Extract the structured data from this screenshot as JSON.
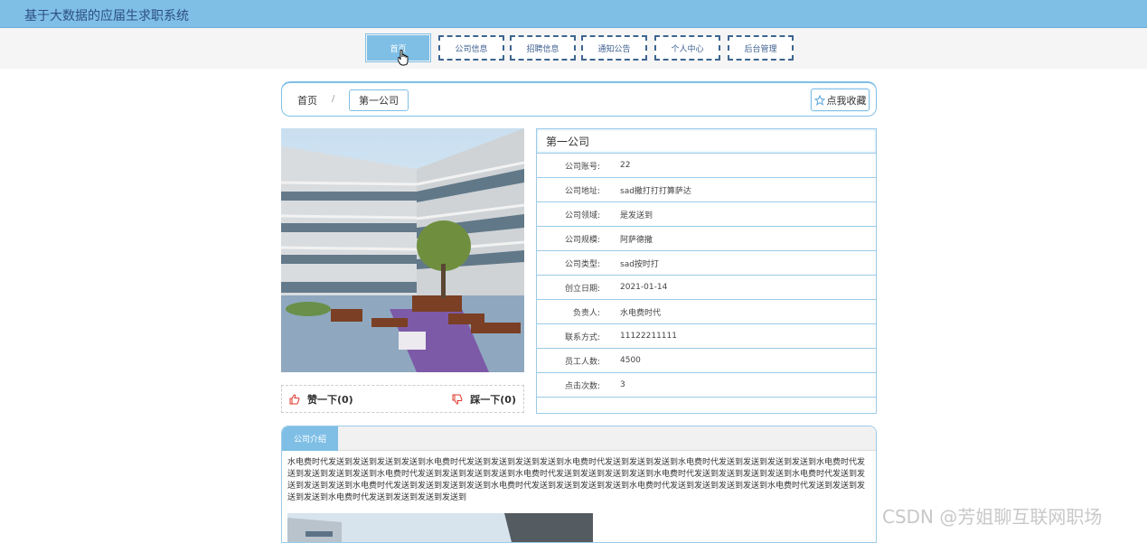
{
  "app": {
    "title": "基于大数据的应届生求职系统"
  },
  "nav": {
    "items": [
      {
        "label": "首页"
      },
      {
        "label": "公司信息"
      },
      {
        "label": "招聘信息"
      },
      {
        "label": "通知公告"
      },
      {
        "label": "个人中心"
      },
      {
        "label": "后台管理"
      }
    ]
  },
  "breadcrumb": {
    "home": "首页",
    "separator": "/",
    "current": "第一公司"
  },
  "favorite": {
    "label": "点我收藏",
    "icon": "star-icon"
  },
  "votes": {
    "like": "赞一下(0)",
    "dislike": "踩一下(0)"
  },
  "company": {
    "name": "第一公司",
    "fields": [
      {
        "label": "公司账号:",
        "value": "22"
      },
      {
        "label": "公司地址:",
        "value": "sad撒打打打算萨达"
      },
      {
        "label": "公司领域:",
        "value": "是发送到"
      },
      {
        "label": "公司规模:",
        "value": "阿萨德撒"
      },
      {
        "label": "公司类型:",
        "value": "sad按时打"
      },
      {
        "label": "创立日期:",
        "value": "2021-01-14"
      },
      {
        "label": "负责人:",
        "value": "水电费时代"
      },
      {
        "label": "联系方式:",
        "value": "11122211111"
      },
      {
        "label": "员工人数:",
        "value": "4500"
      },
      {
        "label": "点击次数:",
        "value": "3"
      }
    ]
  },
  "intro": {
    "tab": "公司介绍",
    "text": "水电费时代发送到发送到发送到发送到水电费时代发送到发送到发送到发送到水电费时代发送到发送到发送到水电费时代发送到发送到发送到发送到水电费时代发送到发送到发送到发送到水电费时代发送到发送到发送到发送到水电费时代发送到发送到发送到发送到水电费时代发送到发送到发送到发送到水电费时代发送到发送到发送到发送到水电费时代发送到发送到发送到发送到水电费时代发送到发送到发送到发送到水电费时代发送到发送到发送到发送到水电费时代发送到发送到发送到发送到水电费时代发送到发送到发送到发送到"
  },
  "watermark": "CSDN @芳姐聊互联网职场",
  "colors": {
    "accent": "#7fbfe6",
    "nav_border": "#3d6590",
    "table_border": "#9ccbe8"
  }
}
